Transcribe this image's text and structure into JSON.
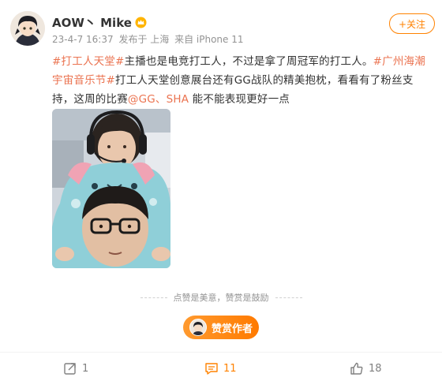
{
  "user": {
    "name": "AOW丶 Mike",
    "badge_icon": "vip-crown-icon"
  },
  "meta": {
    "time": "23-4-7 16:37",
    "location": "发布于 上海",
    "source": "来自 iPhone 11"
  },
  "follow_button": {
    "label": "+关注"
  },
  "post": {
    "tag1": "#打工人天堂#",
    "text1": "主播也是电竞打工人，不过是拿了周冠军的打工人。",
    "tag2": "#广州海潮宇宙音乐节#",
    "text2": "打工人天堂创意展台还有GG战队的精美抱枕，看看有了粉丝支持，这周的比赛",
    "mention": "@GG、SHA",
    "text3": " 能不能表现更好一点",
    "image_label": "post-photo"
  },
  "reward": {
    "caption": "点赞是美意，赞赏是鼓励",
    "button_label": "赞赏作者"
  },
  "actions": {
    "forward_count": "1",
    "comment_count": "11",
    "like_count": "18"
  },
  "colors": {
    "accent": "#ff8200",
    "link": "#eb7350",
    "muted": "#939393"
  }
}
